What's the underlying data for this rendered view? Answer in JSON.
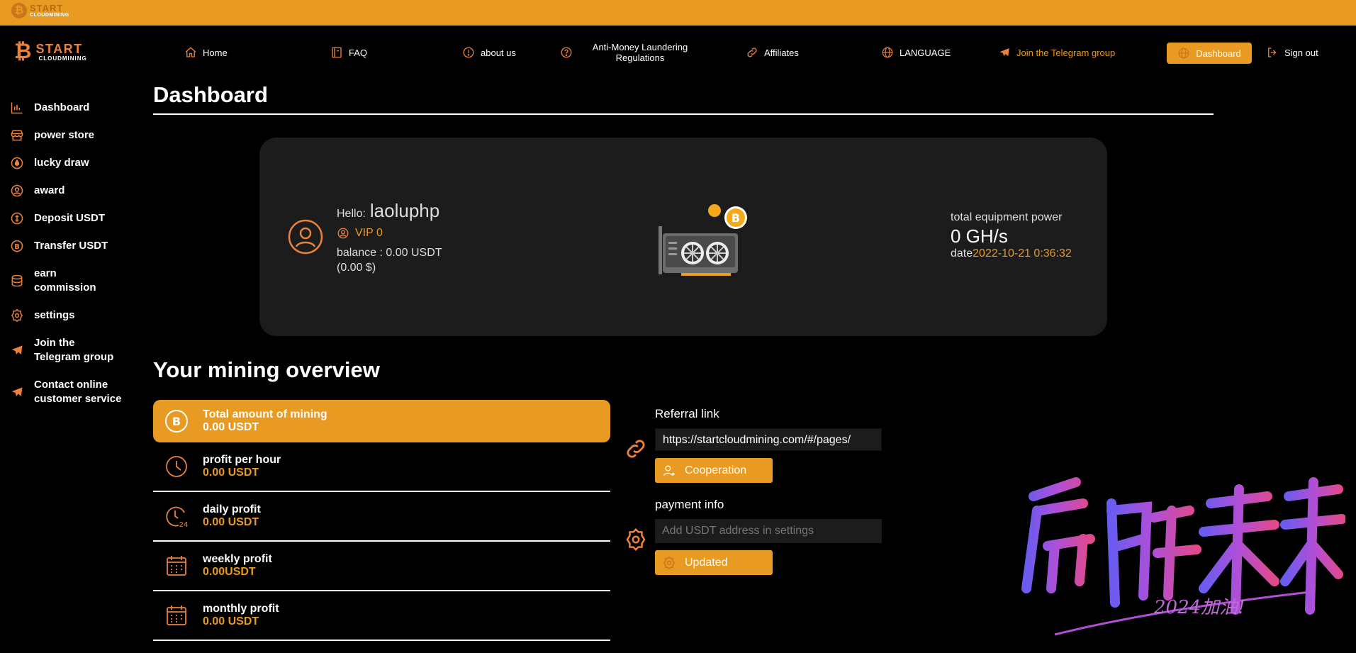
{
  "topbar": {
    "logo_text": "START",
    "logo_sub": "CLOUDMINING"
  },
  "brand": {
    "name": "START",
    "sub": "CLOUDMINING"
  },
  "nav": {
    "home": "Home",
    "faq": "FAQ",
    "about": "about us",
    "aml": "Anti-Money Laundering Regulations",
    "affiliates": "Affiliates",
    "language": "LANGUAGE",
    "telegram": "Join the Telegram group",
    "dashboard": "Dashboard",
    "signout": "Sign out"
  },
  "sidebar": {
    "items": [
      {
        "label": "Dashboard"
      },
      {
        "label": "power store"
      },
      {
        "label": "lucky draw"
      },
      {
        "label": "award"
      },
      {
        "label": "Deposit USDT"
      },
      {
        "label": "Transfer USDT"
      },
      {
        "label": "earn commission"
      },
      {
        "label": "settings"
      },
      {
        "label": "Join the Telegram group"
      },
      {
        "label": "Contact online customer service"
      }
    ]
  },
  "page": {
    "title": "Dashboard",
    "overview_title": "Your mining overview"
  },
  "account": {
    "hello_label": "Hello:",
    "username": "laoluphp",
    "vip": "VIP 0",
    "balance": "balance : 0.00 USDT",
    "balance_usd": "(0.00 $)",
    "power_label": "total equipment power",
    "power_value": "0 GH/s",
    "date_label": "date",
    "date_value": "2022-10-21 0:36:32"
  },
  "stats": [
    {
      "title": "Total amount of mining",
      "value": "0.00 USDT"
    },
    {
      "title": "profit per hour",
      "value": "0.00 USDT"
    },
    {
      "title": "daily profit",
      "value": "0.00 USDT"
    },
    {
      "title": "weekly profit",
      "value": "0.00USDT"
    },
    {
      "title": "monthly profit",
      "value": "0.00 USDT"
    }
  ],
  "referral": {
    "label": "Referral link",
    "link": "https://startcloudmining.com/#/pages/",
    "button": "Cooperation"
  },
  "payment": {
    "label": "payment info",
    "placeholder": "Add USDT address in settings",
    "button": "Updated"
  },
  "colors": {
    "accent": "#e89a22",
    "card": "#1c1c1c",
    "background": "#000000"
  }
}
